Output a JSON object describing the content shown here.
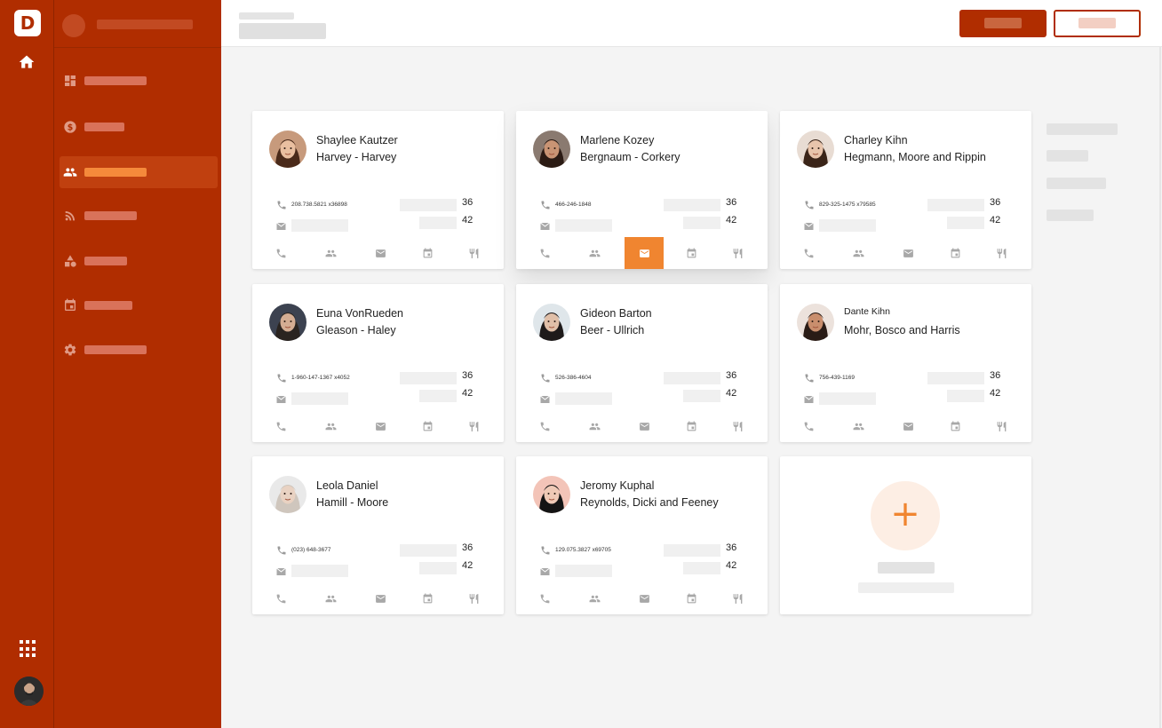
{
  "brand": {
    "logo_letter": "D",
    "accent": "#f08530",
    "primary": "#b02d00"
  },
  "rail": {
    "icons": [
      "home-icon",
      "apps-grid-icon",
      "user-avatar"
    ]
  },
  "sidebar": {
    "items": [
      {
        "icon": "dashboard-icon"
      },
      {
        "icon": "dollar-icon"
      },
      {
        "icon": "contacts-icon",
        "active": true
      },
      {
        "icon": "rss-icon"
      },
      {
        "icon": "shapes-icon"
      },
      {
        "icon": "calendar-icon"
      },
      {
        "icon": "gear-icon"
      }
    ]
  },
  "contacts": [
    {
      "name": "Shaylee Kautzer",
      "company": "Harvey - Harvey",
      "phone": "208.738.5821 x36898",
      "stat1": "36",
      "stat2": "42"
    },
    {
      "name": "Marlene Kozey",
      "company": "Bergnaum - Corkery",
      "phone": "466-246-1848",
      "stat1": "36",
      "stat2": "42",
      "active_action": "email"
    },
    {
      "name": "Charley Kihn",
      "company": "Hegmann, Moore and Rippin",
      "phone": "829-325-1475 x79585",
      "stat1": "36",
      "stat2": "42"
    },
    {
      "name": "Euna VonRueden",
      "company": "Gleason - Haley",
      "phone": "1-960-147-1367 x4052",
      "stat1": "36",
      "stat2": "42"
    },
    {
      "name": "Gideon Barton",
      "company": "Beer - Ullrich",
      "phone": "526-386-4604",
      "stat1": "36",
      "stat2": "42"
    },
    {
      "name": "Dante Kihn",
      "company": "Mohr, Bosco and Harris",
      "phone": "756-439-1169",
      "stat1": "36",
      "stat2": "42"
    },
    {
      "name": "Leola Daniel",
      "company": "Hamill - Moore",
      "phone": "(023) 648-3677",
      "stat1": "36",
      "stat2": "42"
    },
    {
      "name": "Jeromy Kuphal",
      "company": "Reynolds, Dicki and Feeney",
      "phone": "129.075.3827 x69705",
      "stat1": "36",
      "stat2": "42"
    }
  ],
  "card_actions": [
    "phone-icon",
    "people-icon",
    "email-icon",
    "calendar-icon",
    "restaurant-icon"
  ],
  "add_card": {
    "symbol": "+"
  }
}
